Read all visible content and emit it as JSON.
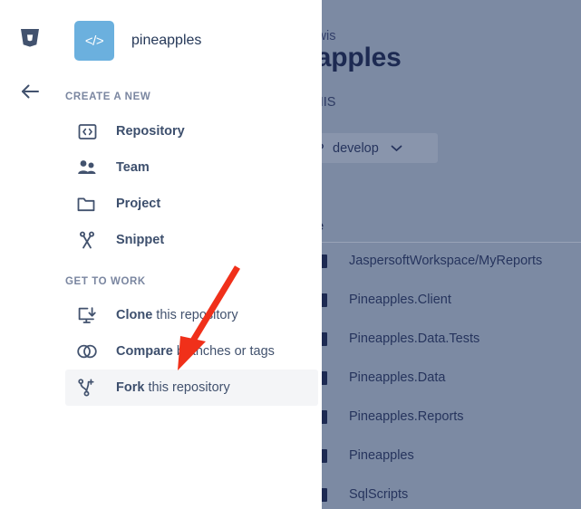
{
  "background_page": {
    "breadcrumb": "ian Lewis",
    "repo_title": "ineapples",
    "subtitle": "cific EMIS",
    "branch_selector": {
      "label": "develop",
      "icon": "branch-icon",
      "caret_icon": "chevron-down-icon"
    },
    "path_separator": "/",
    "column_header_name": "ame",
    "files": [
      "JaspersoftWorkspace/MyReports",
      "Pineapples.Client",
      "Pineapples.Data.Tests",
      "Pineapples.Data",
      "Pineapples.Reports",
      "Pineapples",
      "SqlScripts"
    ]
  },
  "panel": {
    "logo_icon": "bitbucket-logo-icon",
    "back_icon": "back-arrow-icon",
    "repo": {
      "avatar_glyph": "</>",
      "avatar_icon": "code-avatar-icon",
      "name": "pineapples"
    },
    "sections": [
      {
        "label": "CREATE A NEW",
        "items": [
          {
            "icon": "repository-icon",
            "bold": "Repository",
            "rest": ""
          },
          {
            "icon": "team-icon",
            "bold": "Team",
            "rest": ""
          },
          {
            "icon": "project-icon",
            "bold": "Project",
            "rest": ""
          },
          {
            "icon": "snippet-icon",
            "bold": "Snippet",
            "rest": ""
          }
        ]
      },
      {
        "label": "GET TO WORK",
        "items": [
          {
            "icon": "clone-icon",
            "bold": "Clone",
            "rest": " this repository"
          },
          {
            "icon": "compare-icon",
            "bold": "Compare",
            "rest": " branches or tags"
          },
          {
            "icon": "fork-icon",
            "bold": "Fork",
            "rest": " this repository"
          }
        ]
      }
    ],
    "highlighted_item": "Fork this repository"
  },
  "annotation": {
    "type": "red-arrow",
    "color": "#f0301a",
    "points_to": "Fork this repository"
  },
  "colors": {
    "overlay": "#7c8aa3",
    "panel_bg": "#ffffff",
    "avatar_blue": "#6bb0de",
    "text_dark": "#42526e",
    "section_label": "#7a86a0",
    "highlight_row": "#f4f5f7",
    "arrow_red": "#f0301a"
  }
}
